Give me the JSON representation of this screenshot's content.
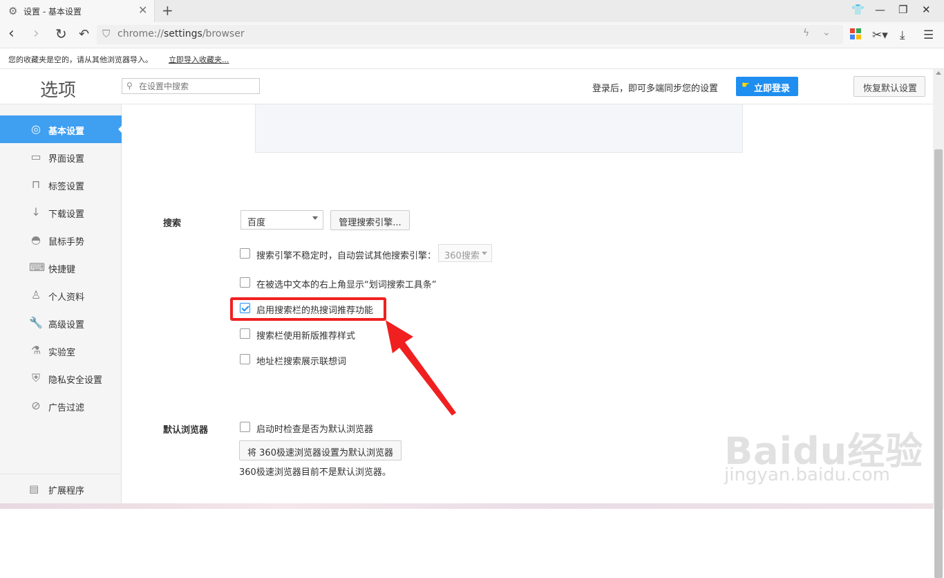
{
  "tab": {
    "title": "设置 - 基本设置"
  },
  "address": {
    "scheme": "chrome://",
    "host": "settings",
    "path": "/browser"
  },
  "bookmark_bar": {
    "message": "您的收藏夹是空的，请从其他浏览器导入。",
    "import_link": "立即导入收藏夹..."
  },
  "header": {
    "title": "选项",
    "search_placeholder": "在设置中搜索",
    "sync_text": "登录后，即可多端同步您的设置",
    "login_button": "立即登录",
    "restore_button": "恢复默认设置"
  },
  "sidebar": {
    "items": [
      {
        "label": "基本设置",
        "icon": "settings-circle-icon",
        "active": true
      },
      {
        "label": "界面设置",
        "icon": "window-icon"
      },
      {
        "label": "标签设置",
        "icon": "tab-icon"
      },
      {
        "label": "下载设置",
        "icon": "download-icon"
      },
      {
        "label": "鼠标手势",
        "icon": "mouse-icon"
      },
      {
        "label": "快捷键",
        "icon": "keyboard-icon"
      },
      {
        "label": "个人资料",
        "icon": "user-icon"
      },
      {
        "label": "高级设置",
        "icon": "wrench-icon"
      },
      {
        "label": "实验室",
        "icon": "lab-icon"
      },
      {
        "label": "隐私安全设置",
        "icon": "shield-icon"
      },
      {
        "label": "广告过滤",
        "icon": "block-icon"
      }
    ],
    "extensions": "扩展程序"
  },
  "search_section": {
    "label": "搜索",
    "engine_value": "百度",
    "manage_button": "管理搜索引擎...",
    "options": [
      {
        "text": "搜索引擎不稳定时，自动尝试其他搜索引擎：",
        "checked": false
      },
      {
        "text": "在被选中文本的右上角显示“划词搜索工具条”",
        "checked": false
      },
      {
        "text": "启用搜索栏的热搜词推荐功能",
        "checked": true
      },
      {
        "text": "搜索栏使用新版推荐样式",
        "checked": false
      },
      {
        "text": "地址栏搜索展示联想词",
        "checked": false
      }
    ],
    "fallback_engine": "360搜索"
  },
  "default_browser": {
    "label": "默认浏览器",
    "check_option": "启动时检查是否为默认浏览器",
    "set_button": "将 360极速浏览器设置为默认浏览器",
    "status": "360极速浏览器目前不是默认浏览器。"
  },
  "watermark": {
    "line1": "Baidu经验",
    "line2": "jingyan.baidu.com"
  },
  "colors": {
    "accent": "#1e8ef0",
    "sidebar_active": "#3f9ff0",
    "highlight": "#f02020"
  }
}
